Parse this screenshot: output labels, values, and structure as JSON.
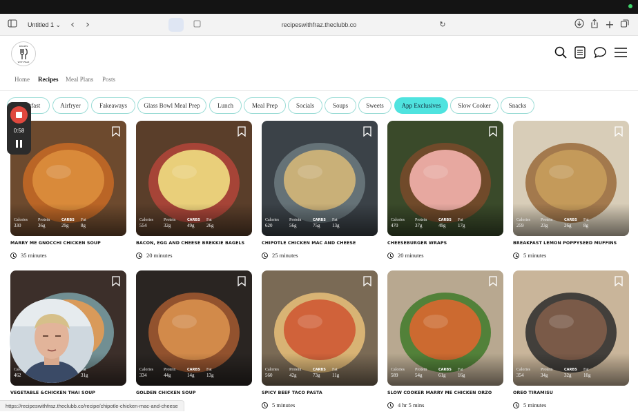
{
  "browser": {
    "tab_title": "Untitled 1",
    "url": "recipeswithfraz.theclubb.co",
    "status_url": "https://recipeswithfraz.theclubb.co/recipe/chipotle-chicken-mac-and-cheese"
  },
  "site": {
    "logo_alt": "RECIPES WITH FRAZ"
  },
  "nav": {
    "items": [
      {
        "label": "Home",
        "active": false
      },
      {
        "label": "Recipes",
        "active": true
      },
      {
        "label": "Meal Plans",
        "active": false
      },
      {
        "label": "Posts",
        "active": false
      }
    ]
  },
  "chips": [
    {
      "label": "Breakfast",
      "active": false
    },
    {
      "label": "Airfryer",
      "active": false
    },
    {
      "label": "Fakeaways",
      "active": false
    },
    {
      "label": "Glass Bowl Meal Prep",
      "active": false
    },
    {
      "label": "Lunch",
      "active": false
    },
    {
      "label": "Meal Prep",
      "active": false
    },
    {
      "label": "Socials",
      "active": false
    },
    {
      "label": "Soups",
      "active": false
    },
    {
      "label": "Sweets",
      "active": false
    },
    {
      "label": "App Exclusives",
      "active": true
    },
    {
      "label": "Slow Cooker",
      "active": false
    },
    {
      "label": "Snacks",
      "active": false
    }
  ],
  "recorder": {
    "time": "0:58"
  },
  "macro_labels": {
    "calories": "Calories",
    "protein": "Protein",
    "carbs": "CARBS",
    "fat": "Fat"
  },
  "recipes": [
    {
      "title": "Marry Me Gnocchi Chicken Soup",
      "time": "35 minutes",
      "calories": "330",
      "protein": "36g",
      "carbs": "29g",
      "fat": "8g"
    },
    {
      "title": "Bacon, Egg and Cheese Brekkie Bagels",
      "time": "20 minutes",
      "calories": "554",
      "protein": "32g",
      "carbs": "49g",
      "fat": "26g"
    },
    {
      "title": "Chipotle Chicken Mac and Cheese",
      "time": "25 minutes",
      "calories": "620",
      "protein": "56g",
      "carbs": "75g",
      "fat": "13g"
    },
    {
      "title": "Cheeseburger Wraps",
      "time": "20 minutes",
      "calories": "470",
      "protein": "37g",
      "carbs": "49g",
      "fat": "17g"
    },
    {
      "title": "Breakfast Lemon Poppyseed Muffins",
      "time": "5 minutes",
      "calories": "259",
      "protein": "23g",
      "carbs": "26g",
      "fat": "8g"
    },
    {
      "title": "Vegetable &Chicken Thai Soup",
      "time": "",
      "calories": "462",
      "protein": "",
      "carbs": "",
      "fat": "31g"
    },
    {
      "title": "Golden Chicken Soup",
      "time": "",
      "calories": "334",
      "protein": "44g",
      "carbs": "14g",
      "fat": "13g"
    },
    {
      "title": "Spicy Beef Taco Pasta",
      "time": "5 minutes",
      "calories": "560",
      "protein": "42g",
      "carbs": "73g",
      "fat": "11g"
    },
    {
      "title": "Slow Cooker Marry Me Chicken Orzo",
      "time": "4 hr 5 mins",
      "calories": "589",
      "protein": "54g",
      "carbs": "61g",
      "fat": "16g"
    },
    {
      "title": "Oreo Tiramisu",
      "time": "5 minutes",
      "calories": "354",
      "protein": "34g",
      "carbs": "32g",
      "fat": "10g"
    }
  ],
  "icons": {
    "sidebar": "sidebar-toggle-icon",
    "back": "chevron-left-icon",
    "forward": "chevron-right-icon",
    "reload": "reload-icon",
    "download": "download-icon",
    "share": "share-icon",
    "newtab": "plus-icon",
    "tabs": "tabs-overview-icon",
    "search": "search-icon",
    "list": "list-icon",
    "chat": "chat-icon",
    "menu": "hamburger-menu-icon",
    "bookmark": "bookmark-icon",
    "clock": "clock-icon"
  },
  "colors": {
    "accent_chip": "#4fe3df",
    "chip_border": "#9bdcd6",
    "record_red": "#e0483e"
  }
}
